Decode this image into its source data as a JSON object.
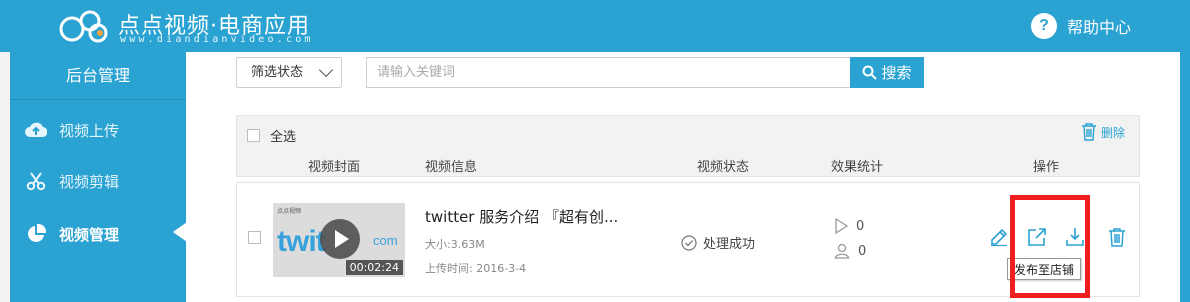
{
  "header": {
    "brand": "点点视频·电商应用",
    "brand_url": "www.diandianvideo.com",
    "help_icon": "question-icon",
    "help_label": "帮助中心"
  },
  "sidebar": {
    "title": "后台管理",
    "items": [
      {
        "label": "视频上传",
        "icon": "cloud-upload-icon"
      },
      {
        "label": "视频剪辑",
        "icon": "scissors-icon"
      },
      {
        "label": "视频管理",
        "icon": "pie-chart-icon",
        "active": true
      }
    ]
  },
  "toolbar": {
    "filter_label": "筛选状态",
    "search_placeholder": "请输入关键词",
    "search_button": "搜索"
  },
  "list": {
    "select_all": "全选",
    "delete_label": "删除",
    "columns": [
      "视频封面",
      "视频信息",
      "视频状态",
      "效果统计",
      "操作"
    ]
  },
  "rows": [
    {
      "thumb_tag": "点点视频",
      "thumb_logo_prefix": "twit",
      "thumb_logo_suffix": "com",
      "duration": "00:02:24",
      "title": "twitter 服务介绍 『超有创...",
      "size": "大小:3.63M",
      "upload_time": "上传时间: 2016-3-4",
      "status": "处理成功",
      "plays": "0",
      "users": "0",
      "actions": [
        {
          "name": "edit-icon"
        },
        {
          "name": "publish-icon",
          "tooltip": "发布至店铺"
        },
        {
          "name": "download-icon"
        },
        {
          "name": "trash-icon"
        }
      ]
    }
  ],
  "colors": {
    "accent": "#2aa3d3",
    "highlight": "#f01e1e"
  }
}
